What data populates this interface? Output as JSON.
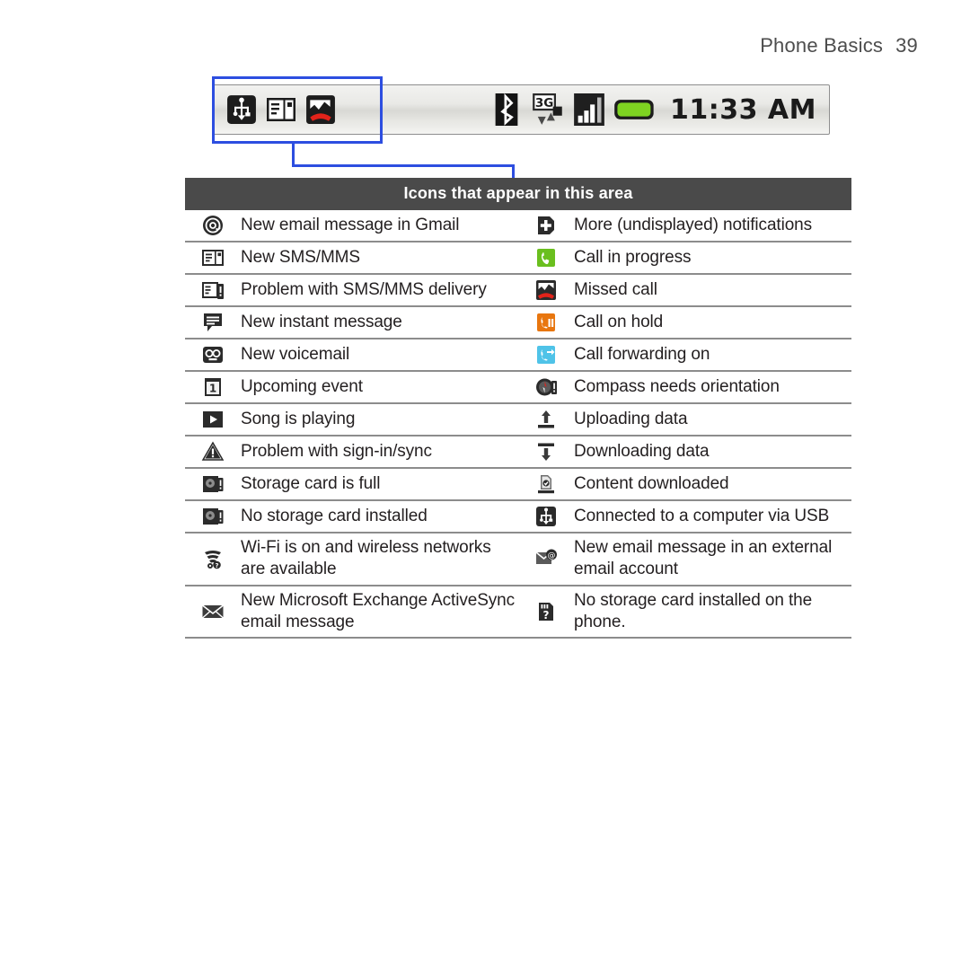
{
  "header": {
    "section": "Phone Basics",
    "page_number": "39"
  },
  "statusbar": {
    "left_icons": [
      {
        "name": "usb-connected-icon",
        "label": "Connected to a computer via USB"
      },
      {
        "name": "new-sms-icon",
        "label": "New SMS/MMS"
      },
      {
        "name": "missed-call-icon",
        "label": "Missed call"
      }
    ],
    "right_icons": [
      {
        "name": "bluetooth-icon",
        "label": "Bluetooth on"
      },
      {
        "name": "3g-data-icon",
        "label": "3G"
      },
      {
        "name": "signal-strength-icon",
        "label": "Signal strength"
      },
      {
        "name": "battery-icon",
        "label": "Battery full"
      }
    ],
    "clock": "11:33 AM",
    "battery_color": "#7ed321",
    "callout_color": "#2d4ee0"
  },
  "table": {
    "title": "Icons that appear in this area",
    "header_bg": "#4a4a4a",
    "rows": [
      {
        "left": {
          "icon": "gmail-at-icon",
          "label": "New email message in Gmail"
        },
        "right": {
          "icon": "more-notifications-icon",
          "label": "More (undisplayed) notifications"
        }
      },
      {
        "left": {
          "icon": "new-sms-mms-icon",
          "label": "New SMS/MMS"
        },
        "right": {
          "icon": "call-in-progress-icon",
          "label": "Call in progress"
        }
      },
      {
        "left": {
          "icon": "sms-delivery-problem-icon",
          "label": "Problem with SMS/MMS delivery"
        },
        "right": {
          "icon": "missed-call-icon",
          "label": "Missed call"
        }
      },
      {
        "left": {
          "icon": "instant-message-icon",
          "label": "New instant message"
        },
        "right": {
          "icon": "call-on-hold-icon",
          "label": "Call on hold"
        }
      },
      {
        "left": {
          "icon": "voicemail-icon",
          "label": "New voicemail"
        },
        "right": {
          "icon": "call-forwarding-icon",
          "label": "Call forwarding on"
        }
      },
      {
        "left": {
          "icon": "upcoming-event-icon",
          "label": "Upcoming event"
        },
        "right": {
          "icon": "compass-orientation-icon",
          "label": "Compass needs orientation"
        }
      },
      {
        "left": {
          "icon": "song-playing-icon",
          "label": "Song is playing"
        },
        "right": {
          "icon": "uploading-data-icon",
          "label": "Uploading data"
        }
      },
      {
        "left": {
          "icon": "sign-in-sync-problem-icon",
          "label": "Problem with sign-in/sync"
        },
        "right": {
          "icon": "downloading-data-icon",
          "label": "Downloading data"
        }
      },
      {
        "left": {
          "icon": "storage-card-full-icon",
          "label": "Storage card is full"
        },
        "right": {
          "icon": "content-downloaded-icon",
          "label": "Content downloaded"
        }
      },
      {
        "left": {
          "icon": "no-storage-card-icon",
          "label": "No storage card installed"
        },
        "right": {
          "icon": "usb-connected-icon",
          "label": "Connected to a computer via USB"
        }
      },
      {
        "left": {
          "icon": "wifi-available-icon",
          "label": "Wi-Fi is on and wireless networks are available"
        },
        "right": {
          "icon": "external-email-icon",
          "label": "New email message in an external email account"
        }
      },
      {
        "left": {
          "icon": "exchange-email-icon",
          "label": "New Microsoft Exchange ActiveSync email message"
        },
        "right": {
          "icon": "no-storage-card-phone-icon",
          "label": "No storage card installed on the phone."
        }
      }
    ]
  }
}
